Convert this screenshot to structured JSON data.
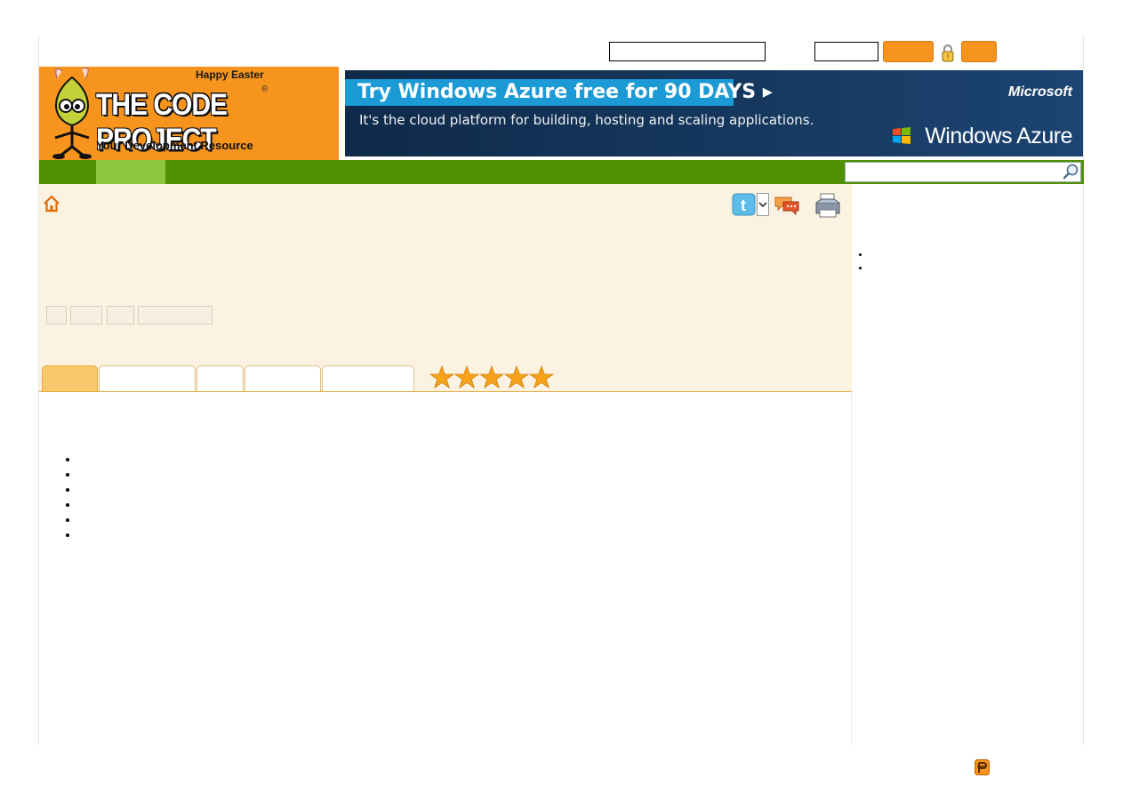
{
  "header": {
    "logo": {
      "holiday_text": "Happy Easter",
      "brand_text": "THE CODE PROJECT",
      "registered_mark": "®",
      "tagline": "Your Development Resource"
    },
    "login": {
      "email_value": "",
      "password_value": "",
      "sign_in_label": "",
      "join_label": ""
    }
  },
  "banner": {
    "headline": "Try Windows Azure free for 90 DAYS ▸",
    "subline": "It's the cloud platform for building, hosting and scaling applications.",
    "vendor": "Microsoft",
    "product": "Windows Azure"
  },
  "nav": {
    "items": [
      {
        "label": ""
      },
      {
        "label": ""
      }
    ],
    "search": {
      "value": "",
      "placeholder": ""
    }
  },
  "article": {
    "action_buttons": [
      {
        "label": ""
      },
      {
        "label": ""
      },
      {
        "label": ""
      },
      {
        "label": ""
      }
    ],
    "tabs": [
      {
        "label": "",
        "active": true
      },
      {
        "label": ""
      },
      {
        "label": ""
      },
      {
        "label": ""
      },
      {
        "label": ""
      }
    ],
    "rating_stars": 5,
    "toc_items": [
      "",
      "",
      "",
      "",
      "",
      ""
    ]
  },
  "sidebar": {
    "list_items": [
      "",
      ""
    ]
  },
  "icons": {
    "home": "home-icon",
    "twitter": "twitter-icon",
    "discuss": "discuss-icon",
    "print": "print-icon",
    "lock": "lock-warning-icon",
    "search": "search-icon",
    "footer": "footer-logo-icon"
  },
  "colors": {
    "brand_orange": "#f7941d",
    "nav_green": "#4f9100",
    "nav_highlight": "#8cc63e",
    "content_bg": "#fbf2e2",
    "azure_blue": "#1b9ad6"
  }
}
